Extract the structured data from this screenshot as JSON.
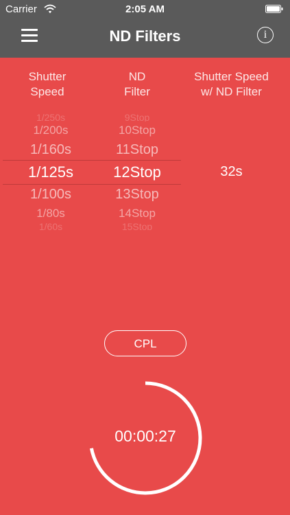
{
  "status_bar": {
    "carrier": "Carrier",
    "time": "2:05 AM"
  },
  "nav": {
    "menu_icon": "hamburger-icon",
    "title": "ND Filters",
    "info_icon": "info-icon",
    "info_glyph": "i"
  },
  "columns": {
    "shutter_speed": {
      "line1": "Shutter",
      "line2": "Speed"
    },
    "nd_filter": {
      "line1": "ND",
      "line2": "Filter"
    },
    "result": {
      "line1": "Shutter Speed",
      "line2": "w/ ND Filter"
    }
  },
  "shutter_picker": {
    "items": [
      "1/250s",
      "1/200s",
      "1/160s",
      "1/125s",
      "1/100s",
      "1/80s",
      "1/60s"
    ],
    "selected": "1/125s"
  },
  "nd_picker": {
    "items": [
      "9Stop",
      "10Stop",
      "11Stop",
      "12Stop",
      "13Stop",
      "14Stop",
      "15Stop"
    ],
    "selected": "12Stop"
  },
  "result_value": "32s",
  "cpl_label": "CPL",
  "timer": {
    "value": "00:00:27",
    "progress": 0.72
  },
  "colors": {
    "background": "#e84a4a",
    "bar": "#5a5a5a",
    "foreground": "#ffffff"
  }
}
